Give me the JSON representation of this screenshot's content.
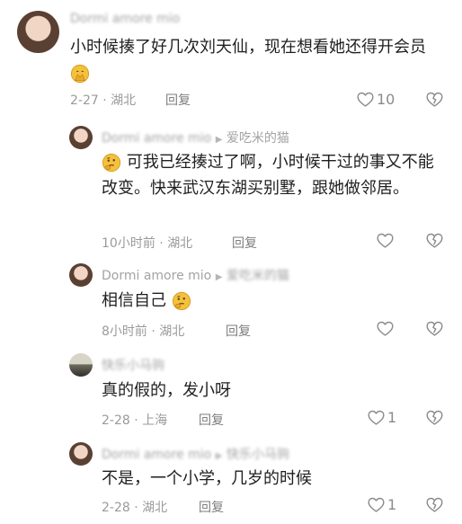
{
  "comments": [
    {
      "user": "Dormi amore mio",
      "text": "小时候揍了好几次刘天仙，现在想看她还得开会员",
      "date": "2-27",
      "location": "湖北",
      "reply_label": "回复",
      "likes": "10"
    },
    {
      "user": "Dormi amore mio",
      "reply_to": "爱吃米的猫",
      "text": "可我已经揍过了啊，小时候干过的事又不能改变。快来武汉东湖买别墅，跟她做邻居。",
      "date": "10小时前",
      "location": "湖北",
      "reply_label": "回复",
      "likes": ""
    },
    {
      "user": "Dormi amore mio",
      "reply_to": "爱吃米的猫",
      "text": "相信自己",
      "date": "8小时前",
      "location": "湖北",
      "reply_label": "回复",
      "likes": ""
    },
    {
      "user": "快乐小马驹",
      "text": "真的假的，发小呀",
      "date": "2-28",
      "location": "上海",
      "reply_label": "回复",
      "likes": "1"
    },
    {
      "user": "Dormi amore mio",
      "reply_to": "快乐小马驹",
      "text": "不是，一个小学，几岁的时候",
      "date": "2-28",
      "location": "湖北",
      "reply_label": "回复",
      "likes": "1"
    }
  ],
  "icons": {
    "like": "heart-outline-icon",
    "dislike": "broken-heart-icon",
    "emoji": "thinking-face-emoji"
  },
  "colors": {
    "name": "#a3a3a3",
    "meta": "#9a9a9a",
    "emoji": "#f4c13d"
  }
}
